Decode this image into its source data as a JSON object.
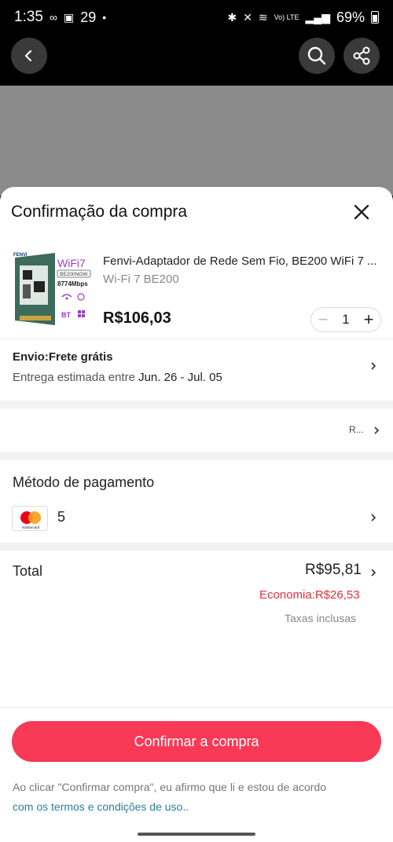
{
  "status_bar": {
    "time": "1:35",
    "temp": "29",
    "battery": "69%",
    "network": "Vo) LTE"
  },
  "nav": {
    "back_icon": "chevron-left-icon",
    "search_icon": "search-icon",
    "share_icon": "share-icon"
  },
  "sheet": {
    "title": "Confirmação da compra"
  },
  "product": {
    "title": "Fenvi-Adaptador de Rede Sem Fio, BE200 WiFi 7 ...",
    "variant": "Wi-Fi 7 BE200",
    "price": "R$106,03",
    "quantity": "1",
    "image_labels": {
      "brand": "FENVI",
      "wifi": "WiFi7",
      "model": "BE200NGW",
      "speed": "8774Mbps"
    }
  },
  "shipping": {
    "title": "Envio:Frete grátis",
    "estimate_prefix": "Entrega estimada entre ",
    "estimate_dates": "Jun. 26 - Jul. 05"
  },
  "address": {
    "blurred": "R..."
  },
  "payment": {
    "title": "Método de pagamento",
    "card_label": "mastercard",
    "card_digit": "5"
  },
  "total": {
    "label": "Total",
    "value": "R$95,81",
    "savings": "Economia:R$26,53",
    "taxes": "Taxas inclusas"
  },
  "actions": {
    "confirm_label": "Confirmar a compra",
    "legal_text": "Ao clicar \"Confirmar compra\", eu afirmo que li e estou de acordo",
    "legal_link": "com os termos e condições de uso.."
  },
  "colors": {
    "accent": "#f83a56",
    "savings": "#e0303c",
    "link": "#2a7f9b"
  }
}
